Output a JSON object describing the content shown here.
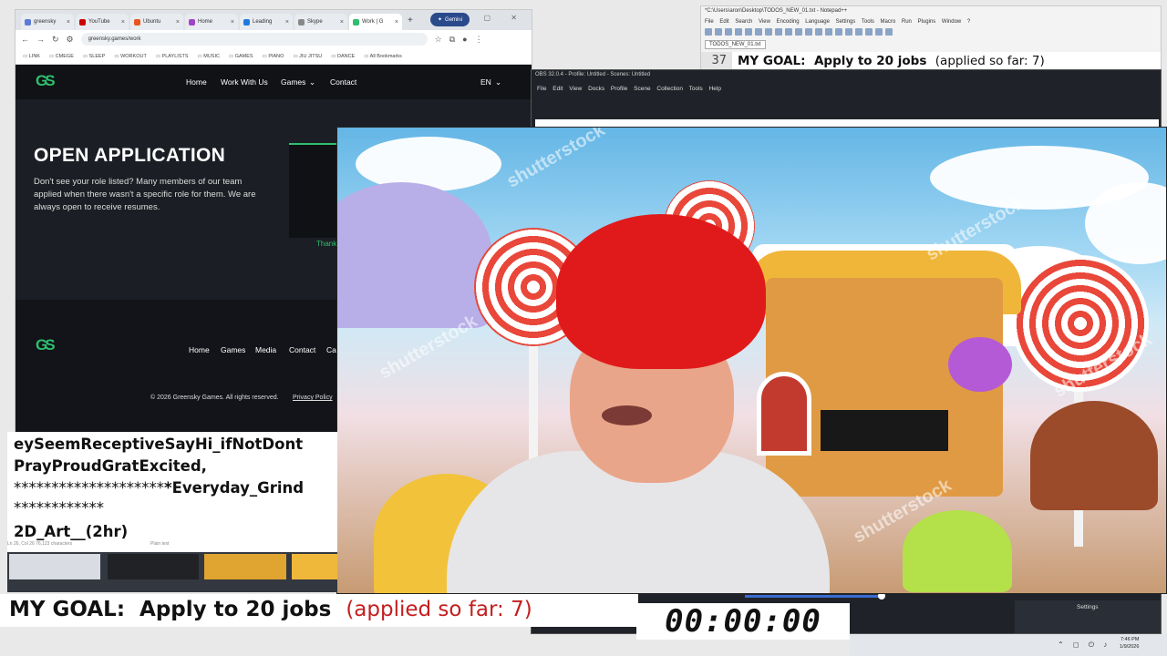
{
  "browser": {
    "tabs": [
      "greensky",
      "YouTube",
      "Ubuntu",
      "Home",
      "Leading",
      "Skype",
      "Work | G"
    ],
    "gemini_label": "Gemini",
    "url": "greensky.games/work",
    "bookmarks": [
      "LINK",
      "CMEGE",
      "SLEEP",
      "WORKOUT",
      "PLAYLISTS",
      "MUSIC",
      "GAMES",
      "PIANO",
      "JIU JITSU",
      "DANCE",
      "All Bookmarks"
    ]
  },
  "site": {
    "logo": "GS",
    "nav": {
      "home": "Home",
      "work": "Work With Us",
      "games": "Games",
      "contact": "Contact",
      "lang": "EN"
    },
    "hero_title": "OPEN APPLICATION",
    "hero_body": "Don't see your role listed? Many members of our team applied when there wasn't a specific role for them. We are always open to receive resumes.",
    "thank_text": "Thank",
    "footer": {
      "links": [
        "Home",
        "Games",
        "Media",
        "Contact",
        "Ca"
      ],
      "copyright": "© 2026 Greensky Games. All rights reserved.",
      "privacy": "Privacy Policy"
    }
  },
  "notepad": {
    "title": "*C:\\Users\\aron\\Desktop\\TODOS_NEW_01.txt - Notepad++",
    "menu": "File Edit Search View Encoding Language Settings Tools Macro Run Plugins Window ?",
    "tab": "TODOS_NEW_01.txt",
    "line_number": "37",
    "goal_line": "MY GOAL:  Apply to 20 jobs  ",
    "goal_progress": "(applied so far: 7)"
  },
  "obs": {
    "title": "OBS 32.0.4 - Profile: Untitled - Scenes: Untitled",
    "menu": "File Edit View Docks Profile Scene Collection Tools Help",
    "settings": "Settings"
  },
  "textpanel": {
    "line1": "eySeemReceptiveSayHi_ifNotDont",
    "line2": "PrayProudGratExcited,",
    "line3_stars": "********************",
    "line3_text": "*Everyday_Grind",
    "line4": "************",
    "line5": "2D_Art__(2hr)",
    "status_left": "Ln 26, Col 26     76,123 characters",
    "status_right": "Plain text"
  },
  "banner": {
    "goal": "MY GOAL:  Apply to 20 jobs  ",
    "progress": "(applied so far: 7)",
    "timer": "00:00:00"
  },
  "clock": {
    "time": "7:46 PM",
    "date": "1/9/2026"
  },
  "colors": {
    "accent_green": "#2fbf6e",
    "progress_red": "#c41e1e",
    "hair_red": "#e01a1a"
  },
  "camera": {
    "watermark": "shutterstock"
  }
}
